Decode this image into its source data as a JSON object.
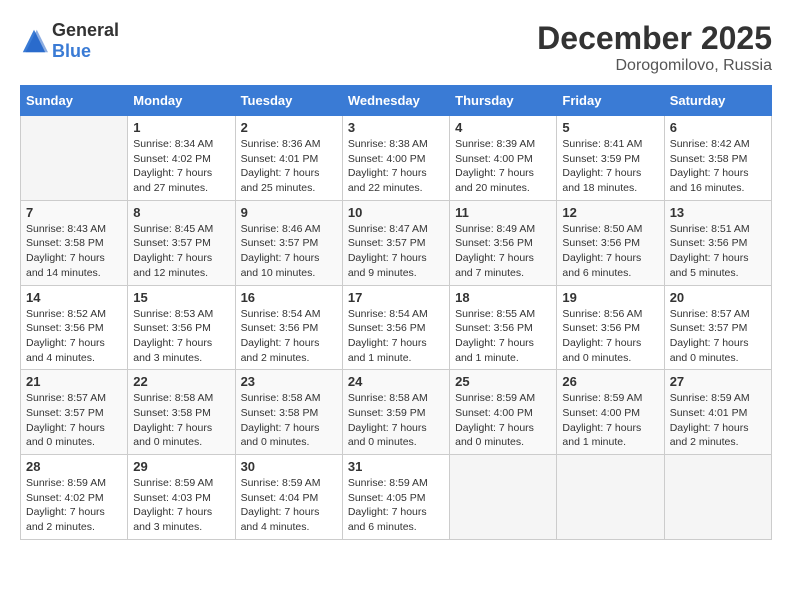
{
  "header": {
    "logo_general": "General",
    "logo_blue": "Blue",
    "month_title": "December 2025",
    "location": "Dorogomilovo, Russia"
  },
  "days_of_week": [
    "Sunday",
    "Monday",
    "Tuesday",
    "Wednesday",
    "Thursday",
    "Friday",
    "Saturday"
  ],
  "weeks": [
    [
      {
        "day": "",
        "info": ""
      },
      {
        "day": "1",
        "info": "Sunrise: 8:34 AM\nSunset: 4:02 PM\nDaylight: 7 hours\nand 27 minutes."
      },
      {
        "day": "2",
        "info": "Sunrise: 8:36 AM\nSunset: 4:01 PM\nDaylight: 7 hours\nand 25 minutes."
      },
      {
        "day": "3",
        "info": "Sunrise: 8:38 AM\nSunset: 4:00 PM\nDaylight: 7 hours\nand 22 minutes."
      },
      {
        "day": "4",
        "info": "Sunrise: 8:39 AM\nSunset: 4:00 PM\nDaylight: 7 hours\nand 20 minutes."
      },
      {
        "day": "5",
        "info": "Sunrise: 8:41 AM\nSunset: 3:59 PM\nDaylight: 7 hours\nand 18 minutes."
      },
      {
        "day": "6",
        "info": "Sunrise: 8:42 AM\nSunset: 3:58 PM\nDaylight: 7 hours\nand 16 minutes."
      }
    ],
    [
      {
        "day": "7",
        "info": "Sunrise: 8:43 AM\nSunset: 3:58 PM\nDaylight: 7 hours\nand 14 minutes."
      },
      {
        "day": "8",
        "info": "Sunrise: 8:45 AM\nSunset: 3:57 PM\nDaylight: 7 hours\nand 12 minutes."
      },
      {
        "day": "9",
        "info": "Sunrise: 8:46 AM\nSunset: 3:57 PM\nDaylight: 7 hours\nand 10 minutes."
      },
      {
        "day": "10",
        "info": "Sunrise: 8:47 AM\nSunset: 3:57 PM\nDaylight: 7 hours\nand 9 minutes."
      },
      {
        "day": "11",
        "info": "Sunrise: 8:49 AM\nSunset: 3:56 PM\nDaylight: 7 hours\nand 7 minutes."
      },
      {
        "day": "12",
        "info": "Sunrise: 8:50 AM\nSunset: 3:56 PM\nDaylight: 7 hours\nand 6 minutes."
      },
      {
        "day": "13",
        "info": "Sunrise: 8:51 AM\nSunset: 3:56 PM\nDaylight: 7 hours\nand 5 minutes."
      }
    ],
    [
      {
        "day": "14",
        "info": "Sunrise: 8:52 AM\nSunset: 3:56 PM\nDaylight: 7 hours\nand 4 minutes."
      },
      {
        "day": "15",
        "info": "Sunrise: 8:53 AM\nSunset: 3:56 PM\nDaylight: 7 hours\nand 3 minutes."
      },
      {
        "day": "16",
        "info": "Sunrise: 8:54 AM\nSunset: 3:56 PM\nDaylight: 7 hours\nand 2 minutes."
      },
      {
        "day": "17",
        "info": "Sunrise: 8:54 AM\nSunset: 3:56 PM\nDaylight: 7 hours\nand 1 minute."
      },
      {
        "day": "18",
        "info": "Sunrise: 8:55 AM\nSunset: 3:56 PM\nDaylight: 7 hours\nand 1 minute."
      },
      {
        "day": "19",
        "info": "Sunrise: 8:56 AM\nSunset: 3:56 PM\nDaylight: 7 hours\nand 0 minutes."
      },
      {
        "day": "20",
        "info": "Sunrise: 8:57 AM\nSunset: 3:57 PM\nDaylight: 7 hours\nand 0 minutes."
      }
    ],
    [
      {
        "day": "21",
        "info": "Sunrise: 8:57 AM\nSunset: 3:57 PM\nDaylight: 7 hours\nand 0 minutes."
      },
      {
        "day": "22",
        "info": "Sunrise: 8:58 AM\nSunset: 3:58 PM\nDaylight: 7 hours\nand 0 minutes."
      },
      {
        "day": "23",
        "info": "Sunrise: 8:58 AM\nSunset: 3:58 PM\nDaylight: 7 hours\nand 0 minutes."
      },
      {
        "day": "24",
        "info": "Sunrise: 8:58 AM\nSunset: 3:59 PM\nDaylight: 7 hours\nand 0 minutes."
      },
      {
        "day": "25",
        "info": "Sunrise: 8:59 AM\nSunset: 4:00 PM\nDaylight: 7 hours\nand 0 minutes."
      },
      {
        "day": "26",
        "info": "Sunrise: 8:59 AM\nSunset: 4:00 PM\nDaylight: 7 hours\nand 1 minute."
      },
      {
        "day": "27",
        "info": "Sunrise: 8:59 AM\nSunset: 4:01 PM\nDaylight: 7 hours\nand 2 minutes."
      }
    ],
    [
      {
        "day": "28",
        "info": "Sunrise: 8:59 AM\nSunset: 4:02 PM\nDaylight: 7 hours\nand 2 minutes."
      },
      {
        "day": "29",
        "info": "Sunrise: 8:59 AM\nSunset: 4:03 PM\nDaylight: 7 hours\nand 3 minutes."
      },
      {
        "day": "30",
        "info": "Sunrise: 8:59 AM\nSunset: 4:04 PM\nDaylight: 7 hours\nand 4 minutes."
      },
      {
        "day": "31",
        "info": "Sunrise: 8:59 AM\nSunset: 4:05 PM\nDaylight: 7 hours\nand 6 minutes."
      },
      {
        "day": "",
        "info": ""
      },
      {
        "day": "",
        "info": ""
      },
      {
        "day": "",
        "info": ""
      }
    ]
  ]
}
